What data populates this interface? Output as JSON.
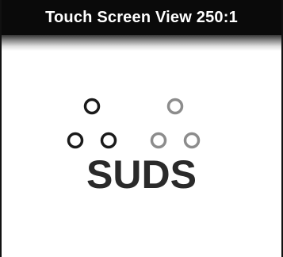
{
  "window": {
    "title": "Touch Screen View 250:1"
  },
  "logo": {
    "text": "SUDS",
    "dark_color": "#1a1a1a",
    "light_color": "#8c8c8c",
    "text_color": "#2a2a2a"
  }
}
